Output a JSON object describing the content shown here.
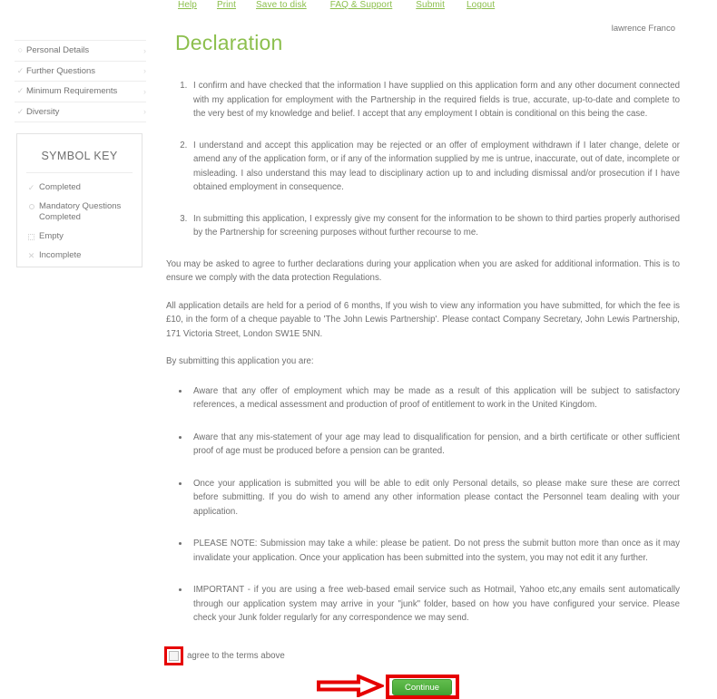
{
  "topnav": {
    "items": [
      {
        "label": "Help"
      },
      {
        "label": "Print"
      },
      {
        "label": "Save to disk"
      },
      {
        "label": "FAQ & Support"
      },
      {
        "label": "Submit"
      },
      {
        "label": "Logout"
      }
    ]
  },
  "user": {
    "name": "lawrence Franco"
  },
  "sidebar": {
    "items": [
      {
        "label": "Personal Details",
        "icon": "circle-icon",
        "glyph": "○",
        "chevron": "›"
      },
      {
        "label": "Further Questions",
        "icon": "check-icon",
        "glyph": "✓",
        "chevron": "›"
      },
      {
        "label": "Minimum Requirements",
        "icon": "check-icon",
        "glyph": "✓",
        "chevron": "›"
      },
      {
        "label": "Diversity",
        "icon": "check-icon",
        "glyph": "✓",
        "chevron": "›"
      }
    ]
  },
  "symbol_key": {
    "title": "SYMBOL KEY",
    "rows": [
      {
        "label": "Completed",
        "icon": "check-icon",
        "glyph": "✓"
      },
      {
        "label": "Mandatory Questions Completed",
        "icon": "circle-icon",
        "glyph": ""
      },
      {
        "label": "Empty",
        "icon": "dotted-box-icon",
        "glyph": ""
      },
      {
        "label": "Incomplete",
        "icon": "cross-icon",
        "glyph": "✕"
      }
    ]
  },
  "main": {
    "title": "Declaration",
    "numbered": [
      "I confirm and have checked that the information I have supplied on this application form and any other document connected with my application for employment with the Partnership in the required fields is true, accurate, up-to-date and complete to the very best of my knowledge and belief. I accept that any employment I obtain is conditional on this being the case.",
      "I understand and accept this application may be rejected or an offer of employment withdrawn if I later change, delete or amend any of the application form, or if any of the information supplied by me is untrue, inaccurate, out of date, incomplete or misleading. I also understand this may lead to disciplinary action up to and including dismissal and/or prosecution if I have obtained employment in consequence.",
      "In submitting this application, I expressly give my consent for the information to be shown to third parties properly authorised by the Partnership for screening purposes without further recourse to me."
    ],
    "para1": "You may be asked to agree to further declarations during your application when you are asked for additional information. This is to ensure we comply with the data protection Regulations.",
    "para2": "All application details are held for a period of 6 months, If you wish to view any information you have submitted, for which the fee is £10, in the form of a cheque payable to 'The John Lewis Partnership'. Please contact Company Secretary, John Lewis Partnership, 171 Victoria Street, London SW1E 5NN.",
    "para3": "By submitting this application you are:",
    "bullets": [
      "Aware that any offer of employment which may be made as a result of this application will be subject to satisfactory references, a medical assessment and production of proof of entitlement to work in the United Kingdom.",
      "Aware that any mis-statement of your age may lead to disqualification for pension, and a birth certificate or other sufficient proof of age must be produced before a pension can be granted.",
      "Once your application is submitted you will be able to edit only Personal details, so please make sure these are correct before submitting. If you do wish to amend any other information please contact the Personnel team dealing with your application.",
      "PLEASE NOTE: Submission may take a while: please be patient. Do not press the submit button more than once as it may invalidate your application. Once your application has been submitted into the system, you may not edit it any further.",
      "IMPORTANT - if you are using a free web-based email service such as Hotmail, Yahoo etc,any emails sent automatically through our application system may arrive in your \"junk\" folder, based on how you have configured your service. Please check your Junk folder regularly for any correspondence we may send."
    ]
  },
  "agree": {
    "label": "agree to the terms above",
    "checked": false
  },
  "continue_button": {
    "label": "Continue"
  },
  "colors": {
    "accent_green": "#8cbf4d",
    "button_green": "#4caf3d",
    "annotation_red": "#e60000",
    "body_text": "#6f6f6f"
  }
}
